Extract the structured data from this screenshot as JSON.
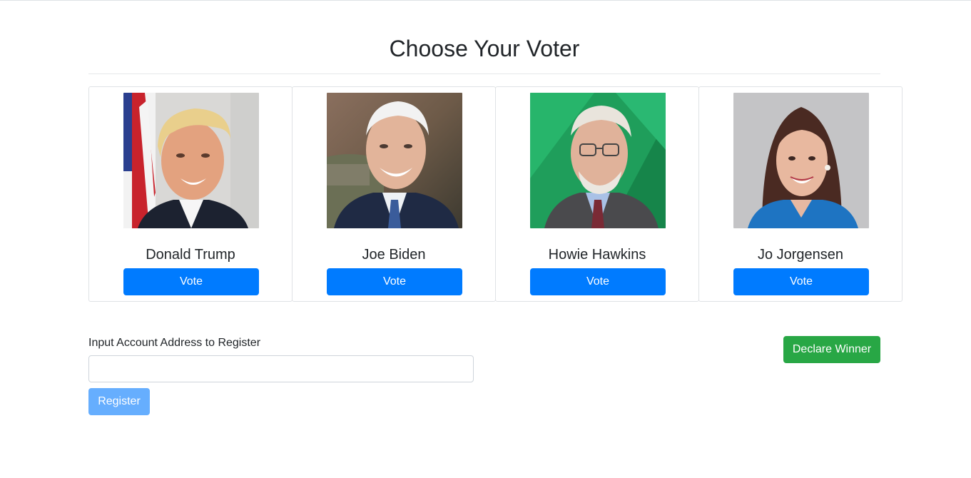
{
  "page": {
    "title": "Choose Your Voter"
  },
  "candidates": [
    {
      "name": "Donald Trump",
      "vote_label": "Vote",
      "photo": "portrait-blonde-man-flag-background"
    },
    {
      "name": "Joe Biden",
      "vote_label": "Vote",
      "photo": "portrait-white-haired-man-painting-background"
    },
    {
      "name": "Howie Hawkins",
      "vote_label": "Vote",
      "photo": "portrait-bearded-man-green-background"
    },
    {
      "name": "Jo Jorgensen",
      "vote_label": "Vote",
      "photo": "portrait-brunette-woman-gray-background"
    }
  ],
  "register": {
    "label": "Input Account Address to Register",
    "input_value": "",
    "input_placeholder": "",
    "button_label": "Register"
  },
  "declare": {
    "button_label": "Declare Winner"
  },
  "colors": {
    "primary": "#007bff",
    "primary_disabled": "#66aefe",
    "success": "#28a745",
    "border": "#dfe2e5"
  }
}
